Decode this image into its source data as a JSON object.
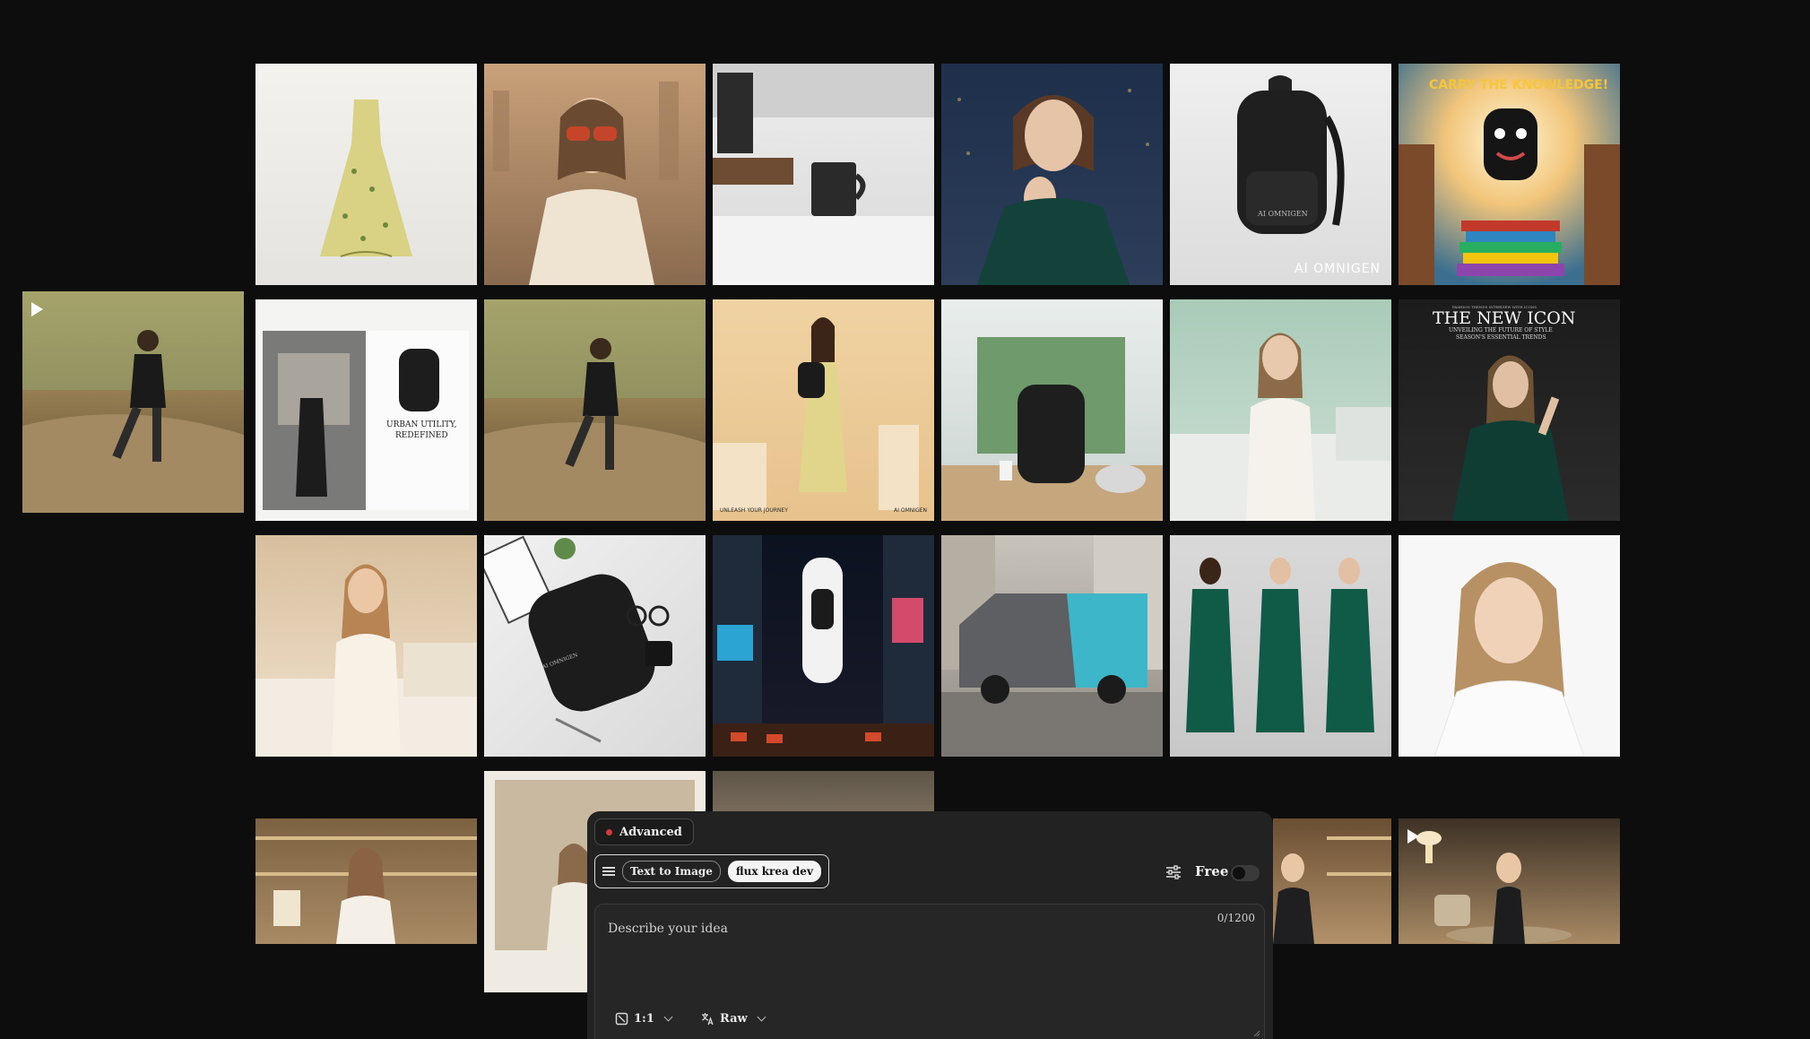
{
  "gallery": {
    "tiles": {
      "summer_dress": {
        "alt": "Floral summer dress"
      },
      "sunglasses_woman": {
        "alt": "Woman in sunglasses"
      },
      "coffee_mug": {
        "alt": "Branded coffee mug on kitchen counter"
      },
      "ring_portrait": {
        "alt": "Woman with ring, city night"
      },
      "backpack_product": {
        "alt": "Black backpack product shot",
        "brand": "AI OMNIGEN",
        "bag_print": "AI OMNIGEN"
      },
      "carry_knowledge": {
        "alt": "Cartoon backpack with books",
        "headline": "CARRY THE KNOWLEDGE!"
      },
      "runner_video": {
        "alt": "Runner on dirt trail (video)"
      },
      "magazine_spread": {
        "alt": "Magazine spread with backpack",
        "headline_line1": "URBAN UTILITY,",
        "headline_line2": "REDEFINED"
      },
      "runner_image": {
        "alt": "Runner on dirt trail"
      },
      "dress_backpack": {
        "alt": "Woman with backpack in floral dress",
        "caption": "UNLEASH YOUR JOURNEY",
        "brand": "AI OMNIGEN"
      },
      "backpack_desk": {
        "alt": "Backpack on desk with window"
      },
      "woman_bed_white": {
        "alt": "Woman sitting on bed in white"
      },
      "new_icon_cover": {
        "alt": "Magazine cover",
        "kicker": "FASHION TRENDS INTERVIEW WITH ICONS",
        "title": "THE NEW ICON",
        "sub1": "UNVEILING THE FUTURE OF STYLE",
        "sub2": "SEASON'S ESSENTIAL TRENDS"
      },
      "woman_bed_warm": {
        "alt": "Woman sitting on bed warm light"
      },
      "flatlay_backpack": {
        "alt": "Flat lay backpack with mug and glasses",
        "bag_print": "AI OMNIGEN"
      },
      "times_square": {
        "alt": "Times Square billboard with backpack"
      },
      "delivery_van": {
        "alt": "Branded delivery van in city"
      },
      "green_robes": {
        "alt": "Three models in green satin robes"
      },
      "portrait_white": {
        "alt": "Portrait of woman on white"
      },
      "shelf_woman": {
        "alt": "Woman in front of bookshelf"
      },
      "polaroid_woman": {
        "alt": "Vintage photo woman"
      },
      "partial_tile": {
        "alt": "Partially loaded image"
      },
      "suit_woman_1": {
        "alt": "Woman in suit, bookshelves"
      },
      "suit_woman_2": {
        "alt": "Woman in suit, lounge (video)"
      }
    }
  },
  "composer": {
    "mode_label": "Advanced",
    "mode_chip": "Text to Image",
    "model_chip": "flux krea dev",
    "free_label": "Free",
    "prompt_placeholder": "Describe your idea",
    "char_count": "0/1200",
    "ratio_label": "1:1",
    "style_label": "Raw"
  }
}
